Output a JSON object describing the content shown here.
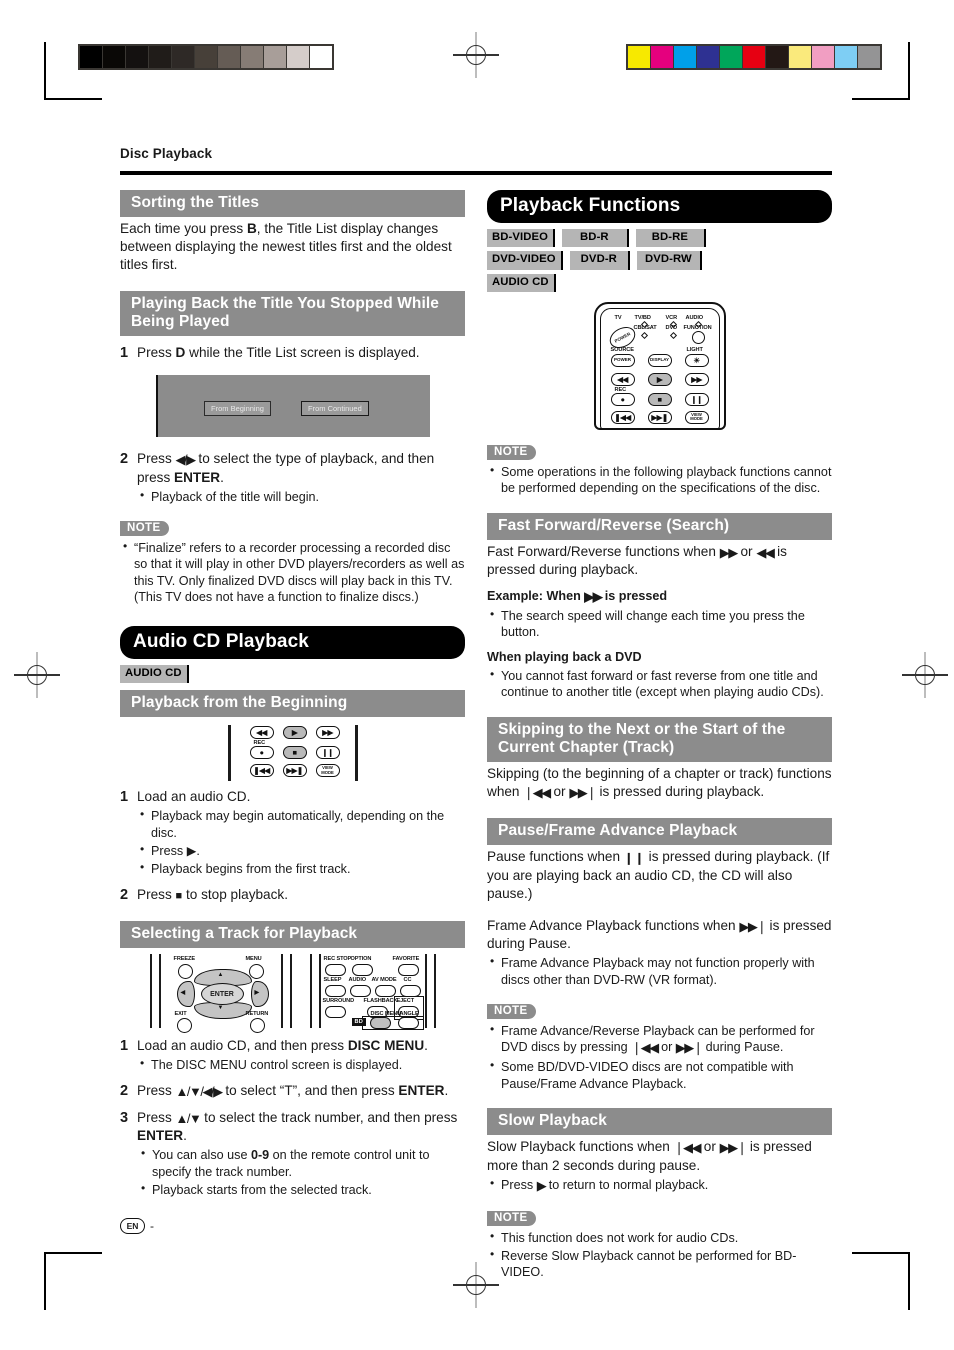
{
  "running_head": "Disc Playback",
  "footer": {
    "lang_badge": "EN",
    "page_mark": "-"
  },
  "calibration": {
    "greyscale": [
      "#000000",
      "#0a0806",
      "#141110",
      "#201c19",
      "#2e2926",
      "#474039",
      "#655c55",
      "#867c75",
      "#a89e99",
      "#d5cdca",
      "#ffffff"
    ],
    "colorbar": [
      "#f7e900",
      "#e5007e",
      "#00a0e9",
      "#2e3192",
      "#00a65a",
      "#e60012",
      "#231815",
      "#faea7c",
      "#f19ec2",
      "#7ecef4",
      "#949495"
    ]
  },
  "left": {
    "sorting": {
      "heading": "Sorting the Titles",
      "body_1": "Each time you press ",
      "body_key": "B",
      "body_2": ", the Title List display changes between displaying the newest titles first and the oldest titles first."
    },
    "resume": {
      "heading": "Playing Back the Title You Stopped While Being Played",
      "step1_num": "1",
      "step1_a": "Press ",
      "step1_key": "D",
      "step1_b": " while the Title List screen is displayed.",
      "osd_from_beginning": "From Beginning",
      "osd_from_continued": "From Continued",
      "step2_num": "2",
      "step2_a": "Press ",
      "step2_arrows": "◀/▶",
      "step2_b": " to select the type of playback, and then press ",
      "step2_key": "ENTER",
      "step2_c": ".",
      "step2_bullets": [
        "Playback of the title will begin."
      ],
      "note_label": "NOTE",
      "note_bullets": [
        "“Finalize” refers to a recorder processing a recorded disc so that it will play in other DVD players/recorders as well as this TV. Only finalized DVD discs will play back in this TV. (This TV does not have a function to finalize discs.)"
      ]
    },
    "audio_cd": {
      "chapter_title": "Audio CD Playback",
      "badge": "AUDIO CD",
      "from_beginning": {
        "heading": "Playback from the Beginning",
        "step1_num": "1",
        "step1": "Load an audio CD.",
        "step1_bullets": [
          "Playback may begin automatically, depending on the disc.",
          "Press ▶.",
          "Playback begins from the first track."
        ],
        "step2_num": "2",
        "step2_a": "Press ",
        "step2_glyph": "■",
        "step2_b": " to stop playback."
      },
      "select_track": {
        "heading": "Selecting a Track for Playback",
        "step1_num": "1",
        "step1_a": "Load an audio CD, and then press ",
        "step1_key": "DISC MENU",
        "step1_b": ".",
        "step1_bullets": [
          "The DISC MENU control screen is displayed."
        ],
        "step2_num": "2",
        "step2_a": "Press ",
        "step2_arrows": "▲/▼/◀/▶",
        "step2_b": " to select “T”, and then press ",
        "step2_key": "ENTER",
        "step2_c": ".",
        "step3_num": "3",
        "step3_a": "Press ",
        "step3_arrows": "▲/▼",
        "step3_b": " to select the track number, and then press ",
        "step3_key": "ENTER",
        "step3_c": ".",
        "step3_bullets_a": "You can also use ",
        "step3_bullets_key": "0-9",
        "step3_bullets_b": " on the remote control unit to specify the track number.",
        "step3_bullet2": "Playback starts from the selected track."
      }
    },
    "remote_transport": {
      "labels": {
        "rec": "REC",
        "view_mode": "VIEW MODE"
      },
      "keys": [
        "◀◀",
        "▶",
        "▶▶",
        "●",
        "■",
        "❙❙",
        "◀◀❘",
        "❘▶▶",
        "VIEW MODE"
      ]
    },
    "remote_cursor": {
      "freeze": "FREEZE",
      "menu": "MENU",
      "enter": "ENTER",
      "exit": "EXIT",
      "return": "RETURN",
      "up": "▲",
      "down": "▼",
      "left": "◀",
      "right": "▶"
    },
    "remote_keypad": {
      "rec_stop": "REC STOP",
      "option": "OPTION",
      "favorite": "FAVORITE",
      "sleep": "SLEEP",
      "audio": "AUDIO",
      "av_mode": "AV MODE",
      "cc": "CC",
      "surround": "SURROUND",
      "flashback": "FLASHBACK",
      "eject": "EJECT",
      "disc_menu": "DISC MENU",
      "angle": "ANGLE",
      "bd": "BD"
    }
  },
  "right": {
    "chapter_title": "Playback Functions",
    "badges": [
      [
        "BD-VIDEO",
        "BD-R",
        "BD-RE"
      ],
      [
        "DVD-VIDEO",
        "DVD-R",
        "DVD-RW"
      ],
      [
        "AUDIO CD"
      ]
    ],
    "bigremote": {
      "tv": "TV",
      "tv_bd": "TV/BD",
      "vcr": "VCR",
      "audio": "AUDIO",
      "cbl_sat": "CBL/SAT",
      "dvd": "DVD",
      "function": "FUNCTION",
      "power": "POWER",
      "source": "SOURCE",
      "source_key": "POWER",
      "display": "DISPLAY",
      "light": "LIGHT",
      "light_key": "☀",
      "rec": "REC",
      "view_mode": "VIEW MODE"
    },
    "top_note": {
      "label": "NOTE",
      "bullets": [
        "Some operations in the following playback functions cannot be performed depending on the specifications of the disc."
      ]
    },
    "ffwd": {
      "heading": "Fast Forward/Reverse (Search)",
      "body_a": "Fast Forward/Reverse functions when ",
      "body_g1": "▶▶",
      "body_b": " or ",
      "body_g2": "◀◀",
      "body_c": " is pressed during playback.",
      "example_a": "Example: When ",
      "example_g": "▶▶",
      "example_b": " is pressed",
      "example_bullets": [
        "The search speed will change each time you press the button."
      ],
      "dvd_sub": "When playing back a DVD",
      "dvd_bullets": [
        "You cannot fast forward or fast reverse from one title and continue to another title (except when playing audio CDs)."
      ]
    },
    "skipping": {
      "heading": "Skipping to the Next or the Start of the Current Chapter (Track)",
      "body_a": "Skipping (to the beginning of a chapter or track) functions when ",
      "body_g1": "❘◀◀",
      "body_b": " or ",
      "body_g2": "▶▶❘",
      "body_c": " is pressed during playback."
    },
    "pause": {
      "heading": "Pause/Frame Advance Playback",
      "body_a": "Pause functions when ",
      "body_g": "❙❙",
      "body_b": " is pressed during playback. (If you are playing back an audio CD, the CD will also pause.)",
      "frame_a": "Frame Advance Playback functions when ",
      "frame_g": "▶▶❘",
      "frame_b": " is pressed during Pause.",
      "frame_bullets": [
        "Frame Advance Playback may not function properly with discs other than DVD-RW (VR format)."
      ],
      "note_label": "NOTE",
      "note_b1_a": "Frame Advance/Reverse Playback can be performed for DVD discs by pressing ",
      "note_b1_g1": "❘◀◀",
      "note_b1_b": " or ",
      "note_b1_g2": "▶▶❘",
      "note_b1_c": " during Pause.",
      "note_b2": "Some BD/DVD-VIDEO discs are not compatible with Pause/Frame Advance Playback."
    },
    "slow": {
      "heading": "Slow Playback",
      "body_a": "Slow Playback functions when ",
      "body_g1": "❘◀◀",
      "body_b": " or ",
      "body_g2": "▶▶❘",
      "body_c": " is pressed more than 2 seconds during pause.",
      "bullet_a": "Press ",
      "bullet_g": "▶",
      "bullet_b": " to return to normal playback.",
      "note_label": "NOTE",
      "note_bullets": [
        "This function does not work for audio CDs.",
        "Reverse Slow Playback cannot be performed for BD-VIDEO."
      ]
    }
  }
}
